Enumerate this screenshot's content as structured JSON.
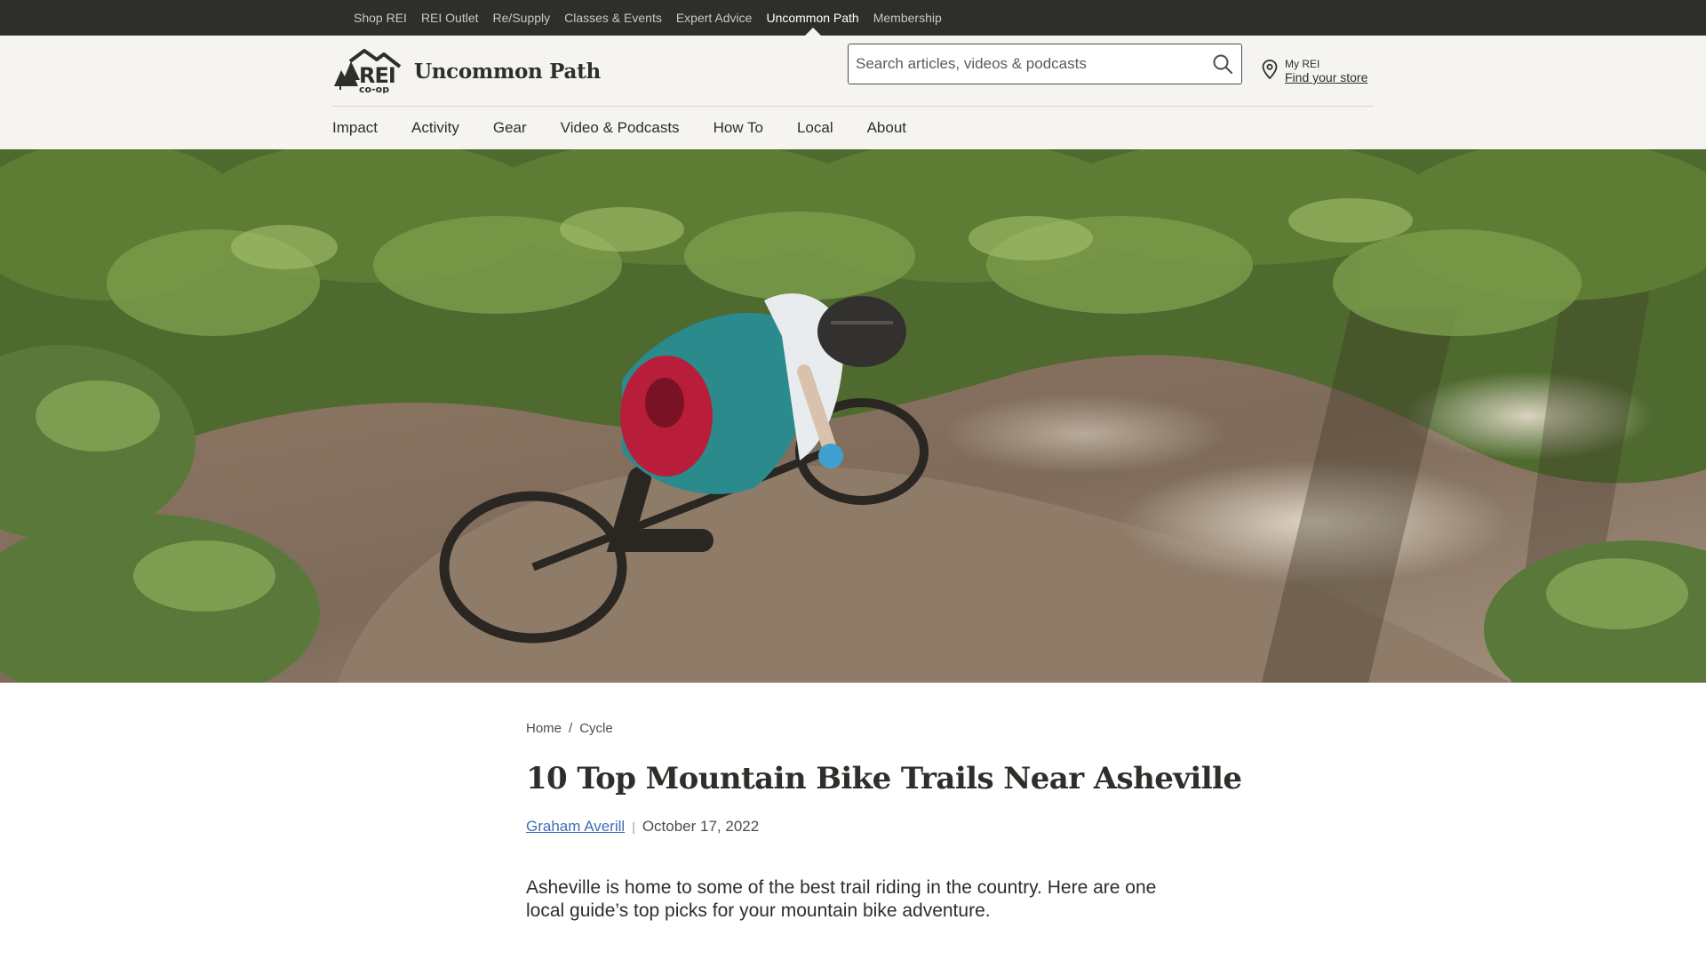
{
  "topbar": {
    "links": [
      {
        "label": "Shop REI"
      },
      {
        "label": "REI Outlet"
      },
      {
        "label": "Re/Supply"
      },
      {
        "label": "Classes & Events"
      },
      {
        "label": "Expert Advice"
      },
      {
        "label": "Uncommon Path",
        "active": true
      },
      {
        "label": "Membership"
      }
    ]
  },
  "header": {
    "logo_text": "REI co-op",
    "site_title": "Uncommon Path",
    "search": {
      "placeholder": "Search articles, videos & podcasts",
      "value": ""
    },
    "store": {
      "my_rei": "My REI",
      "find_store": "Find your store"
    }
  },
  "nav": {
    "items": [
      {
        "label": "Impact"
      },
      {
        "label": "Activity"
      },
      {
        "label": "Gear"
      },
      {
        "label": "Video & Podcasts"
      },
      {
        "label": "How To"
      },
      {
        "label": "Local"
      },
      {
        "label": "About"
      }
    ]
  },
  "hero": {
    "alt": "Mountain biker riding a dirt trail through a forest"
  },
  "article": {
    "breadcrumb": {
      "home": "Home",
      "separator": "/",
      "section": "Cycle"
    },
    "title": "10 Top Mountain Bike Trails Near Asheville",
    "author": "Graham Averill",
    "byline_separator": "|",
    "date": "October 17, 2022",
    "lede": "Asheville is home to some of the best trail riding in the country. Here are one local guide’s top picks for your mountain bike adventure."
  },
  "colors": {
    "topbar_bg": "#2e2e2b",
    "header_bg": "#f5f4f0",
    "text": "#2e2e2b",
    "link": "#406eb3"
  },
  "icons": [
    "rei-logo-icon",
    "search-icon",
    "map-pin-icon"
  ]
}
